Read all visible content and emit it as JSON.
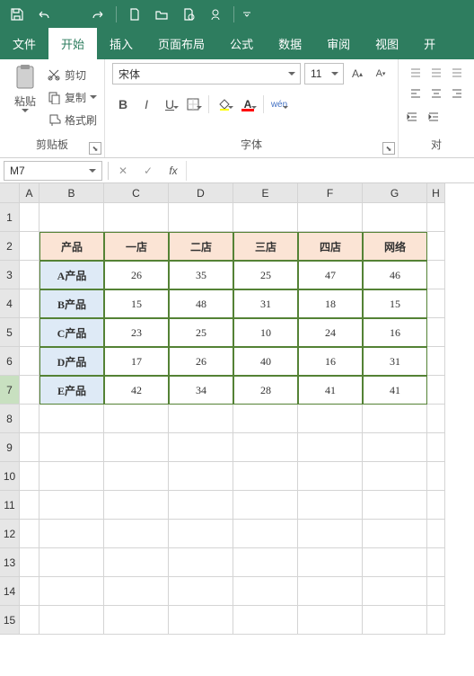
{
  "qat": {
    "save": "save",
    "undo": "undo",
    "redo": "redo",
    "new": "new",
    "open": "open",
    "preview": "preview",
    "wps": "wps"
  },
  "tabs": {
    "file": "文件",
    "start": "开始",
    "insert": "插入",
    "layout": "页面布局",
    "formula": "公式",
    "data": "数据",
    "review": "审阅",
    "view": "视图",
    "dev": "开"
  },
  "ribbon": {
    "clipboard": {
      "label": "剪贴板",
      "paste": "粘贴",
      "cut": "剪切",
      "copy": "复制",
      "painter": "格式刷"
    },
    "font": {
      "label": "字体",
      "name": "宋体",
      "size": "11",
      "bold": "B",
      "italic": "I",
      "underline": "U",
      "wen": "wén"
    },
    "align": {
      "label": "对"
    }
  },
  "namebox": "M7",
  "fx": "fx",
  "cols": [
    "A",
    "B",
    "C",
    "D",
    "E",
    "F",
    "G",
    "H"
  ],
  "rows": [
    "1",
    "2",
    "3",
    "4",
    "5",
    "6",
    "7",
    "8",
    "9",
    "10",
    "11",
    "12",
    "13",
    "14",
    "15"
  ],
  "chart_data": {
    "type": "table",
    "title": "",
    "columns": [
      "产品",
      "一店",
      "二店",
      "三店",
      "四店",
      "网络"
    ],
    "rows": [
      {
        "name": "A产品",
        "values": [
          26,
          35,
          25,
          47,
          46
        ]
      },
      {
        "name": "B产品",
        "values": [
          15,
          48,
          31,
          18,
          15
        ]
      },
      {
        "name": "C产品",
        "values": [
          23,
          25,
          10,
          24,
          16
        ]
      },
      {
        "name": "D产品",
        "values": [
          17,
          26,
          40,
          16,
          31
        ]
      },
      {
        "name": "E产品",
        "values": [
          42,
          34,
          28,
          41,
          41
        ]
      }
    ]
  }
}
